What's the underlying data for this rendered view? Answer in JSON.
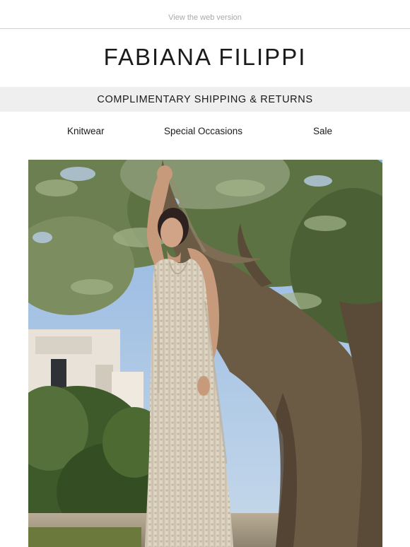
{
  "header": {
    "web_version_link": "View the web version",
    "brand_name": "FABIANA FILIPPI"
  },
  "banner": {
    "shipping_text": "COMPLIMENTARY SHIPPING & RETURNS"
  },
  "nav": {
    "items": [
      {
        "label": "Knitwear"
      },
      {
        "label": "Special Occasions"
      },
      {
        "label": "Sale"
      }
    ]
  },
  "hero": {
    "image_subject": "model-in-crochet-dress-olive-tree-photo"
  },
  "colors": {
    "banner_bg": "#efefef",
    "text": "#1a1a1a",
    "muted": "#a9a9a9"
  }
}
